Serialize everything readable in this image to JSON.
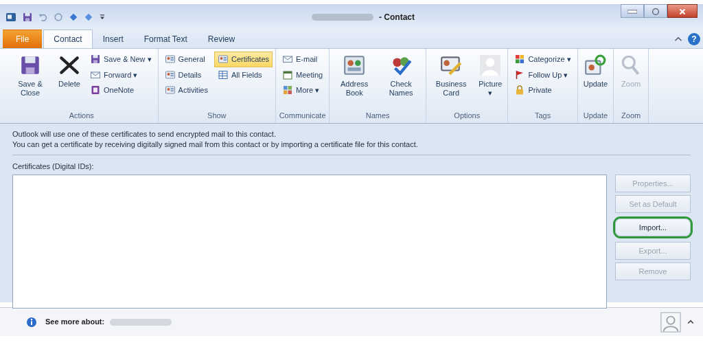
{
  "window": {
    "title": "- Contact",
    "help": "?"
  },
  "tabs": [
    {
      "label": "File",
      "kind": "file",
      "selected": false
    },
    {
      "label": "Contact",
      "kind": "tab",
      "selected": true
    },
    {
      "label": "Insert",
      "kind": "tab",
      "selected": false
    },
    {
      "label": "Format Text",
      "kind": "tab",
      "selected": false
    },
    {
      "label": "Review",
      "kind": "tab",
      "selected": false
    }
  ],
  "ribbon": [
    {
      "label": "Actions",
      "columns": [
        {
          "kind": "large",
          "label": "Save & Close",
          "disabled": false
        },
        {
          "kind": "large",
          "label": "Delete",
          "disabled": false
        },
        {
          "kind": "stack",
          "items": [
            {
              "label": "Save & New",
              "caret": "▾",
              "selected": false
            },
            {
              "label": "Forward",
              "caret": "▾",
              "selected": false
            },
            {
              "label": "OneNote",
              "selected": false
            }
          ]
        }
      ]
    },
    {
      "label": "Show",
      "columns": [
        {
          "kind": "stack",
          "items": [
            {
              "label": "General",
              "selected": false
            },
            {
              "label": "Details",
              "selected": false
            },
            {
              "label": "Activities",
              "selected": false
            }
          ]
        },
        {
          "kind": "stack",
          "items": [
            {
              "label": "Certificates",
              "selected": true
            },
            {
              "label": "All Fields",
              "selected": false
            }
          ]
        }
      ]
    },
    {
      "label": "Communicate",
      "columns": [
        {
          "kind": "stack",
          "items": [
            {
              "label": "E-mail",
              "selected": false
            },
            {
              "label": "Meeting",
              "selected": false
            },
            {
              "label": "More",
              "caret": "▾",
              "selected": false
            }
          ]
        }
      ]
    },
    {
      "label": "Names",
      "columns": [
        {
          "kind": "large",
          "label": "Address Book",
          "disabled": false
        },
        {
          "kind": "large",
          "label": "Check Names",
          "disabled": false
        }
      ]
    },
    {
      "label": "Options",
      "columns": [
        {
          "kind": "large",
          "label": "Business Card",
          "disabled": false
        },
        {
          "kind": "large",
          "label": "Picture",
          "caret": "▾",
          "disabled": false
        }
      ]
    },
    {
      "label": "Tags",
      "columns": [
        {
          "kind": "stack",
          "items": [
            {
              "label": "Categorize",
              "caret": "▾",
              "selected": false
            },
            {
              "label": "Follow Up",
              "caret": "▾",
              "selected": false
            },
            {
              "label": "Private",
              "selected": false
            }
          ]
        }
      ]
    },
    {
      "label": "Update",
      "columns": [
        {
          "kind": "large",
          "label": "Update",
          "disabled": false
        }
      ]
    },
    {
      "label": "Zoom",
      "columns": [
        {
          "kind": "large",
          "label": "Zoom",
          "disabled": true
        }
      ]
    }
  ],
  "content": {
    "lines": [
      "Outlook will use one of these certificates to send encrypted mail to this contact.",
      "You can get a certificate by receiving digitally signed mail from this contact or by importing a certificate file for this contact."
    ],
    "list_label": "Certificates (Digital IDs):",
    "buttons": [
      {
        "label": "Properties...",
        "disabled": true,
        "circled": false
      },
      {
        "label": "Set as Default",
        "disabled": true,
        "circled": false
      },
      {
        "label": "Import...",
        "disabled": false,
        "circled": true
      },
      {
        "label": "Export...",
        "disabled": true,
        "circled": false
      },
      {
        "label": "Remove",
        "disabled": true,
        "circled": false
      }
    ]
  },
  "footer": {
    "text": "See more about:"
  }
}
